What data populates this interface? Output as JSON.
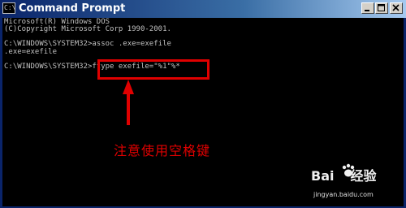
{
  "window": {
    "title": "Command Prompt",
    "icon": "console-icon",
    "icon_glyph": "C:\\",
    "controls": {
      "minimize_icon": "minimize-icon",
      "maximize_icon": "maximize-icon",
      "close_icon": "close-icon"
    }
  },
  "console": {
    "lines": [
      "Microsoft(R) Windows DOS",
      "(C)Copyright Microsoft Corp 1990-2001.",
      "C:\\WINDOWS\\SYSTEM32>assoc .exe=exefile",
      ".exe=exefile",
      "C:\\WINDOWS\\SYSTEM32>ftype exefile=\"%1\"%*"
    ],
    "background": "#000000",
    "text_color": "#c0c0c0"
  },
  "annotation": {
    "text": "注意使用空格键",
    "color": "#e00000",
    "highlight_color": "#e00000"
  },
  "watermark": {
    "logo_left": "Bai",
    "logo_right": "经验",
    "url": "jingyan.baidu.com"
  }
}
